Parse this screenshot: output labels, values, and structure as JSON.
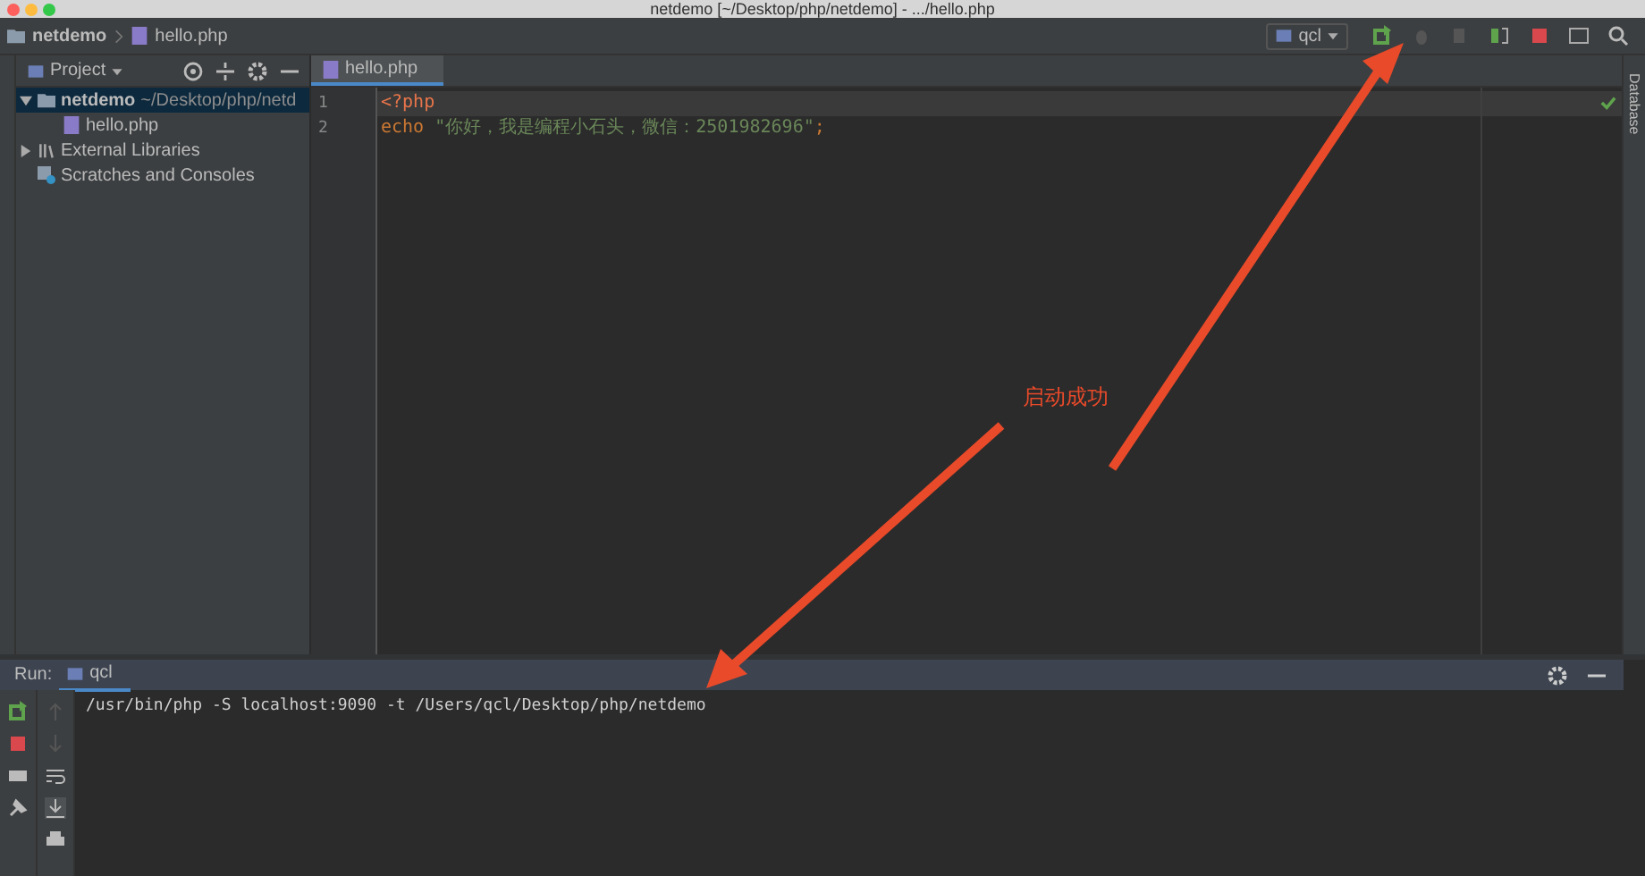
{
  "window": {
    "title": "netdemo [~/Desktop/php/netdemo] - .../hello.php"
  },
  "navbar": {
    "breadcrumbs": [
      "netdemo",
      "hello.php"
    ],
    "run_config": "qcl"
  },
  "project": {
    "title": "Project",
    "tree": [
      {
        "label": "netdemo",
        "path": "~/Desktop/php/netd",
        "kind": "folder",
        "expanded": true,
        "selected": true,
        "children": [
          {
            "label": "hello.php",
            "kind": "php",
            "selected": false
          }
        ]
      },
      {
        "label": "External Libraries",
        "kind": "libraries",
        "expanded": false,
        "selected": false
      },
      {
        "label": "Scratches and Consoles",
        "kind": "scratches",
        "selected": false
      }
    ]
  },
  "editor": {
    "tabs": [
      {
        "label": "hello.php",
        "selected": true
      }
    ],
    "lines": [
      {
        "number": "1",
        "current": true,
        "tokens": [
          {
            "text": "<?php",
            "kind": "tag"
          }
        ]
      },
      {
        "number": "2",
        "current": false,
        "tokens": [
          {
            "text": "echo ",
            "kind": "keyword"
          },
          {
            "text": "\"你好，我是编程小石头，微信：2501982696\"",
            "kind": "string"
          },
          {
            "text": ";",
            "kind": "plain"
          }
        ]
      }
    ]
  },
  "right_strip": {
    "label": "Database"
  },
  "run": {
    "label": "Run:",
    "tabs": [
      {
        "label": "qcl",
        "selected": true
      }
    ],
    "output": [
      "/usr/bin/php -S localhost:9090 -t /Users/qcl/Desktop/php/netdemo"
    ]
  },
  "annotation": {
    "text": "启动成功"
  }
}
